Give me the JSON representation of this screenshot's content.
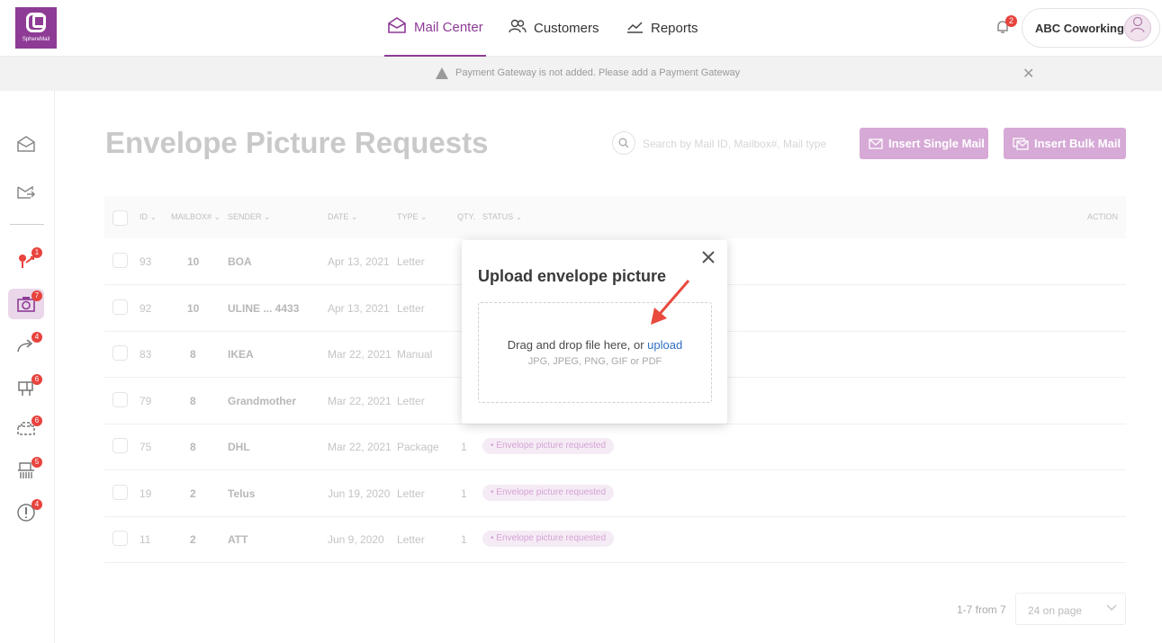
{
  "app": {
    "logo_text": "SphereMail"
  },
  "nav": {
    "mail_center": "Mail Center",
    "customers": "Customers",
    "reports": "Reports"
  },
  "notifications": {
    "count": "2"
  },
  "account": {
    "name": "ABC Coworking"
  },
  "banner": {
    "message": "Payment Gateway is not added. Please add a  Payment Gateway"
  },
  "sidebar": {
    "items": [
      {
        "icon": "mail-open-icon",
        "badge": ""
      },
      {
        "icon": "mail-forward-icon",
        "badge": ""
      },
      {
        "icon": "pickup-icon",
        "badge": "1"
      },
      {
        "icon": "camera-icon",
        "badge": "7"
      },
      {
        "icon": "forward-arrow-icon",
        "badge": "4"
      },
      {
        "icon": "mailbox-icon",
        "badge": "6"
      },
      {
        "icon": "package-icon",
        "badge": "6"
      },
      {
        "icon": "shred-icon",
        "badge": "5"
      },
      {
        "icon": "alert-icon",
        "badge": "4"
      }
    ]
  },
  "page": {
    "title": "Envelope Picture Requests",
    "search_placeholder": "Search by Mail ID, Mailbox#, Mail type",
    "insert_single": "Insert Single Mail",
    "insert_bulk": "Insert Bulk Mail"
  },
  "table": {
    "headers": {
      "id": "ID",
      "mailbox": "MAILBOX#",
      "sender": "SENDER",
      "date": "DATE",
      "type": "TYPE",
      "qty": "QTY.",
      "status": "STATUS",
      "action": "ACTION"
    },
    "rows": [
      {
        "id": "93",
        "mailbox": "10",
        "sender": "BOA",
        "date": "Apr 13, 2021",
        "type": "Letter",
        "qty": "",
        "status": ""
      },
      {
        "id": "92",
        "mailbox": "10",
        "sender": "ULINE ... 4433",
        "date": "Apr 13, 2021",
        "type": "Letter",
        "qty": "",
        "status": ""
      },
      {
        "id": "83",
        "mailbox": "8",
        "sender": "IKEA",
        "date": "Mar 22, 2021",
        "type": "Manual",
        "qty": "",
        "status": ""
      },
      {
        "id": "79",
        "mailbox": "8",
        "sender": "Grandmother",
        "date": "Mar 22, 2021",
        "type": "Letter",
        "qty": "",
        "status": ""
      },
      {
        "id": "75",
        "mailbox": "8",
        "sender": "DHL",
        "date": "Mar 22, 2021",
        "type": "Package",
        "qty": "1",
        "status": "• Envelope picture requested"
      },
      {
        "id": "19",
        "mailbox": "2",
        "sender": "Telus",
        "date": "Jun 19, 2020",
        "type": "Letter",
        "qty": "1",
        "status": "• Envelope picture requested"
      },
      {
        "id": "11",
        "mailbox": "2",
        "sender": "ATT",
        "date": "Jun 9, 2020",
        "type": "Letter",
        "qty": "1",
        "status": "• Envelope picture requested"
      }
    ]
  },
  "pagination": {
    "range": "1-7 from 7",
    "per_page": "24 on page"
  },
  "modal": {
    "title": "Upload envelope picture",
    "drop_text": "Drag and drop file here, or ",
    "upload_link": "upload",
    "formats": "JPG, JPEG, PNG, GIF or PDF"
  },
  "colors": {
    "brand": "#8e3b96",
    "button": "#d6a9d6",
    "badge": "#e8433d",
    "link": "#2f6fc2",
    "arrow": "#e84a3c"
  }
}
